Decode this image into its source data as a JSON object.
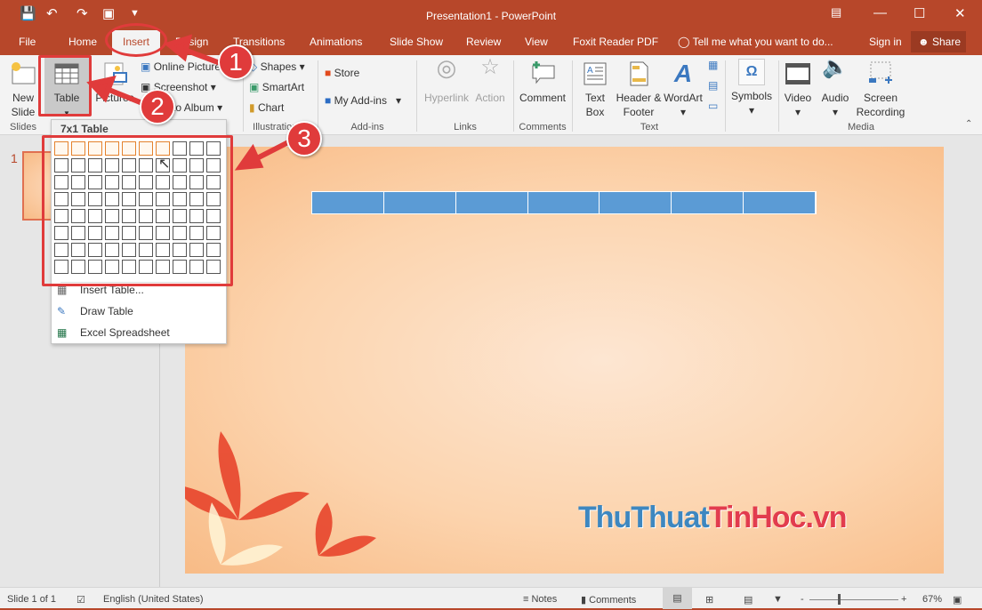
{
  "titlebar": {
    "title": "Presentation1 - PowerPoint",
    "quick_access": [
      "save-icon",
      "undo-icon",
      "redo-icon",
      "start-from-beginning-icon",
      "customize-icon"
    ]
  },
  "tabs": [
    "File",
    "Home",
    "Insert",
    "Design",
    "Transitions",
    "Animations",
    "Slide Show",
    "Review",
    "View",
    "Foxit Reader PDF"
  ],
  "active_tab": "Insert",
  "tell_me": "Tell me what you want to do...",
  "sign_in": "Sign in",
  "share": "Share",
  "ribbon": {
    "new_slide": "New Slide",
    "table": "Table",
    "pictures": "Pictures",
    "online_pictures": "Online Pictures",
    "screenshot": "Screenshot",
    "photo_album": "Photo Album",
    "shapes": "Shapes",
    "smartart": "SmartArt",
    "chart": "Chart",
    "store": "Store",
    "my_addins": "My Add-ins",
    "hyperlink": "Hyperlink",
    "action": "Action",
    "comment": "Comment",
    "text_box": "Text Box",
    "header_footer": "Header & Footer",
    "wordart": "WordArt",
    "symbols": "Symbols",
    "video": "Video",
    "audio": "Audio",
    "screen_recording": "Screen Recording",
    "groups": {
      "slides": "Slides",
      "illustrations": "Illustrations",
      "addins": "Add-ins",
      "links": "Links",
      "comments": "Comments",
      "text": "Text",
      "media": "Media"
    }
  },
  "table_dropdown": {
    "header": "7x1 Table",
    "columns": 10,
    "rows": 8,
    "selected_columns": 7,
    "selected_rows": 1,
    "items": [
      "Insert Table...",
      "Draw Table",
      "Excel Spreadsheet"
    ]
  },
  "thumbnail": {
    "number": "1"
  },
  "slide": {
    "table_columns": 7,
    "table_color": "#5b9bd5",
    "watermark_part1": "ThuThuat",
    "watermark_part2": "TinHoc.vn",
    "watermark_color1": "#3d87c0",
    "watermark_color2": "#e23c4e"
  },
  "annotations": [
    "1",
    "2",
    "3"
  ],
  "statusbar": {
    "slide": "Slide 1 of 1",
    "language": "English (United States)",
    "notes": "Notes",
    "comments": "Comments",
    "zoom": "67%",
    "zoom_level": 67
  },
  "colors": {
    "accent": "#b7472a",
    "annotation": "#e03b3b"
  }
}
